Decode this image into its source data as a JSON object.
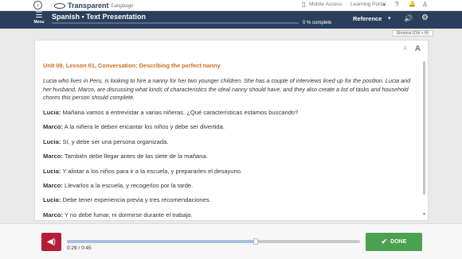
{
  "topbar": {
    "brand_name": "Transparent",
    "brand_sub": "Language",
    "mobile_access": "Mobile Access",
    "learning_portal": "Learning Portal",
    "back_icon": "‹",
    "phone_icon": "▯",
    "portal_chevron": "▾",
    "help_icon": "?",
    "bell_icon": "🔔",
    "user_icon": "♙"
  },
  "header": {
    "menu_icon": "☰",
    "menu_label": "Menu",
    "title": "Spanish • Text Presentation",
    "progress_text": "0 % complete",
    "progress_value": 0,
    "reference_label": "Reference",
    "reference_chevron": "▾",
    "volume_icon": "🔊",
    "settings_icon": "⚙"
  },
  "shortcut": "Shortcut (Ctrl + H)",
  "font_controls": {
    "decrease": "A",
    "increase": "A"
  },
  "lesson": {
    "title": "Unit 09, Lesson 01, Conversation: Describing the perfect nanny",
    "intro": "Lucia who lives in Peru, is looking to hire a nanny for her two younger children. She has a couple of interviews lined up for the position. Lucia and her husband, Marco, are discussing what kinds of characteristics the ideal nanny should have, and they also create a list of tasks and household chores this person should complete.",
    "lines": [
      {
        "speaker": "Lucia:",
        "text": " Mañana vamos a entrevistar a varias niñeras. ¿Qué características estamos buscando?"
      },
      {
        "speaker": "Marco:",
        "text": " A la niñera le deben encantar los niños y debe ser divertida."
      },
      {
        "speaker": "Lucia:",
        "text": " Sí, y debe ser una persona organizada."
      },
      {
        "speaker": "Marco:",
        "text": " También debe llegar antes de las siete de la mañana."
      },
      {
        "speaker": "Lucia:",
        "text": " Y alistar a los niños para ir a la escuela, y prepararles el desayuno."
      },
      {
        "speaker": "Marco:",
        "text": " Llevarlos a la escuela, y recogerlos por la tarde."
      },
      {
        "speaker": "Lucia:",
        "text": " Debe tener experiencia previa y tres recomendaciones."
      },
      {
        "speaker": "Marco:",
        "text": " Y no debe fumar, ni dormirse durante el trabajo."
      }
    ]
  },
  "audio": {
    "speaker_icon": "◀)",
    "time": "0:29 / 0:45",
    "progress_fraction": 0.644
  },
  "done": {
    "check_icon": "✔",
    "label": "DONE"
  },
  "colors": {
    "header_bg": "#2b3f5c",
    "lesson_title": "#cc6e1e",
    "audio_button": "#b31f3a",
    "done_button": "#4aa14f"
  }
}
